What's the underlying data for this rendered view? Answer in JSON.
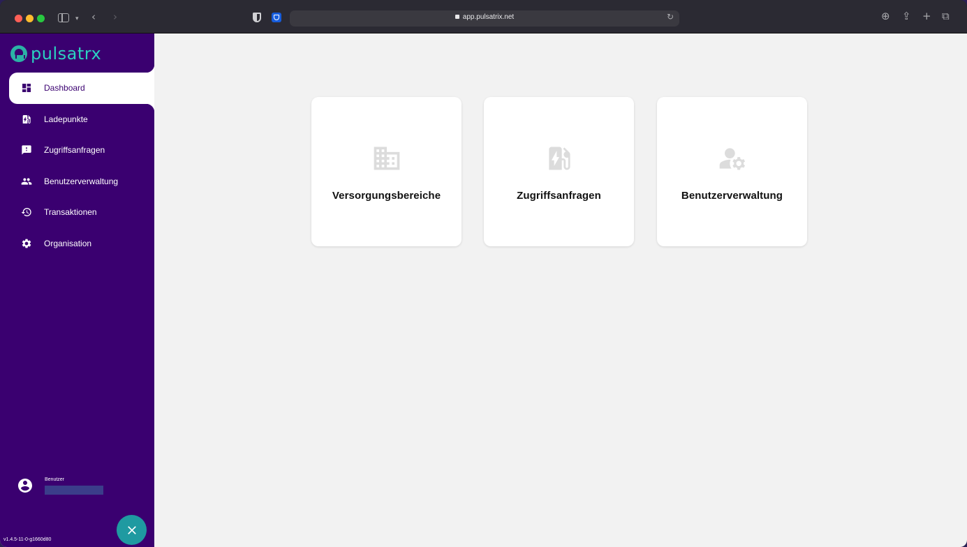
{
  "browser": {
    "url": "app.pulsatrix.net",
    "back_icon": "chevron-left-icon",
    "forward_icon": "chevron-right-icon"
  },
  "app": {
    "logo_text": "pulsatrx",
    "brand_color": "#3a0070",
    "accent_color": "#2bd1c0"
  },
  "sidebar": {
    "items": [
      {
        "label": "Dashboard",
        "icon": "dashboard-icon",
        "active": true
      },
      {
        "label": "Ladepunkte",
        "icon": "ev-station-icon",
        "active": false
      },
      {
        "label": "Zugriffsanfragen",
        "icon": "feedback-icon",
        "active": false
      },
      {
        "label": "Benutzerverwaltung",
        "icon": "people-icon",
        "active": false
      },
      {
        "label": "Transaktionen",
        "icon": "history-icon",
        "active": false
      },
      {
        "label": "Organisation",
        "icon": "gear-icon",
        "active": false
      }
    ],
    "user_label": "Benutzer",
    "version": "v1.4.5-11-0-g1660d80"
  },
  "cards": [
    {
      "label": "Versorgungsbereiche",
      "icon": "building-icon"
    },
    {
      "label": "Zugriffsanfragen",
      "icon": "ev-station-icon"
    },
    {
      "label": "Benutzerverwaltung",
      "icon": "manage-accounts-icon"
    }
  ]
}
